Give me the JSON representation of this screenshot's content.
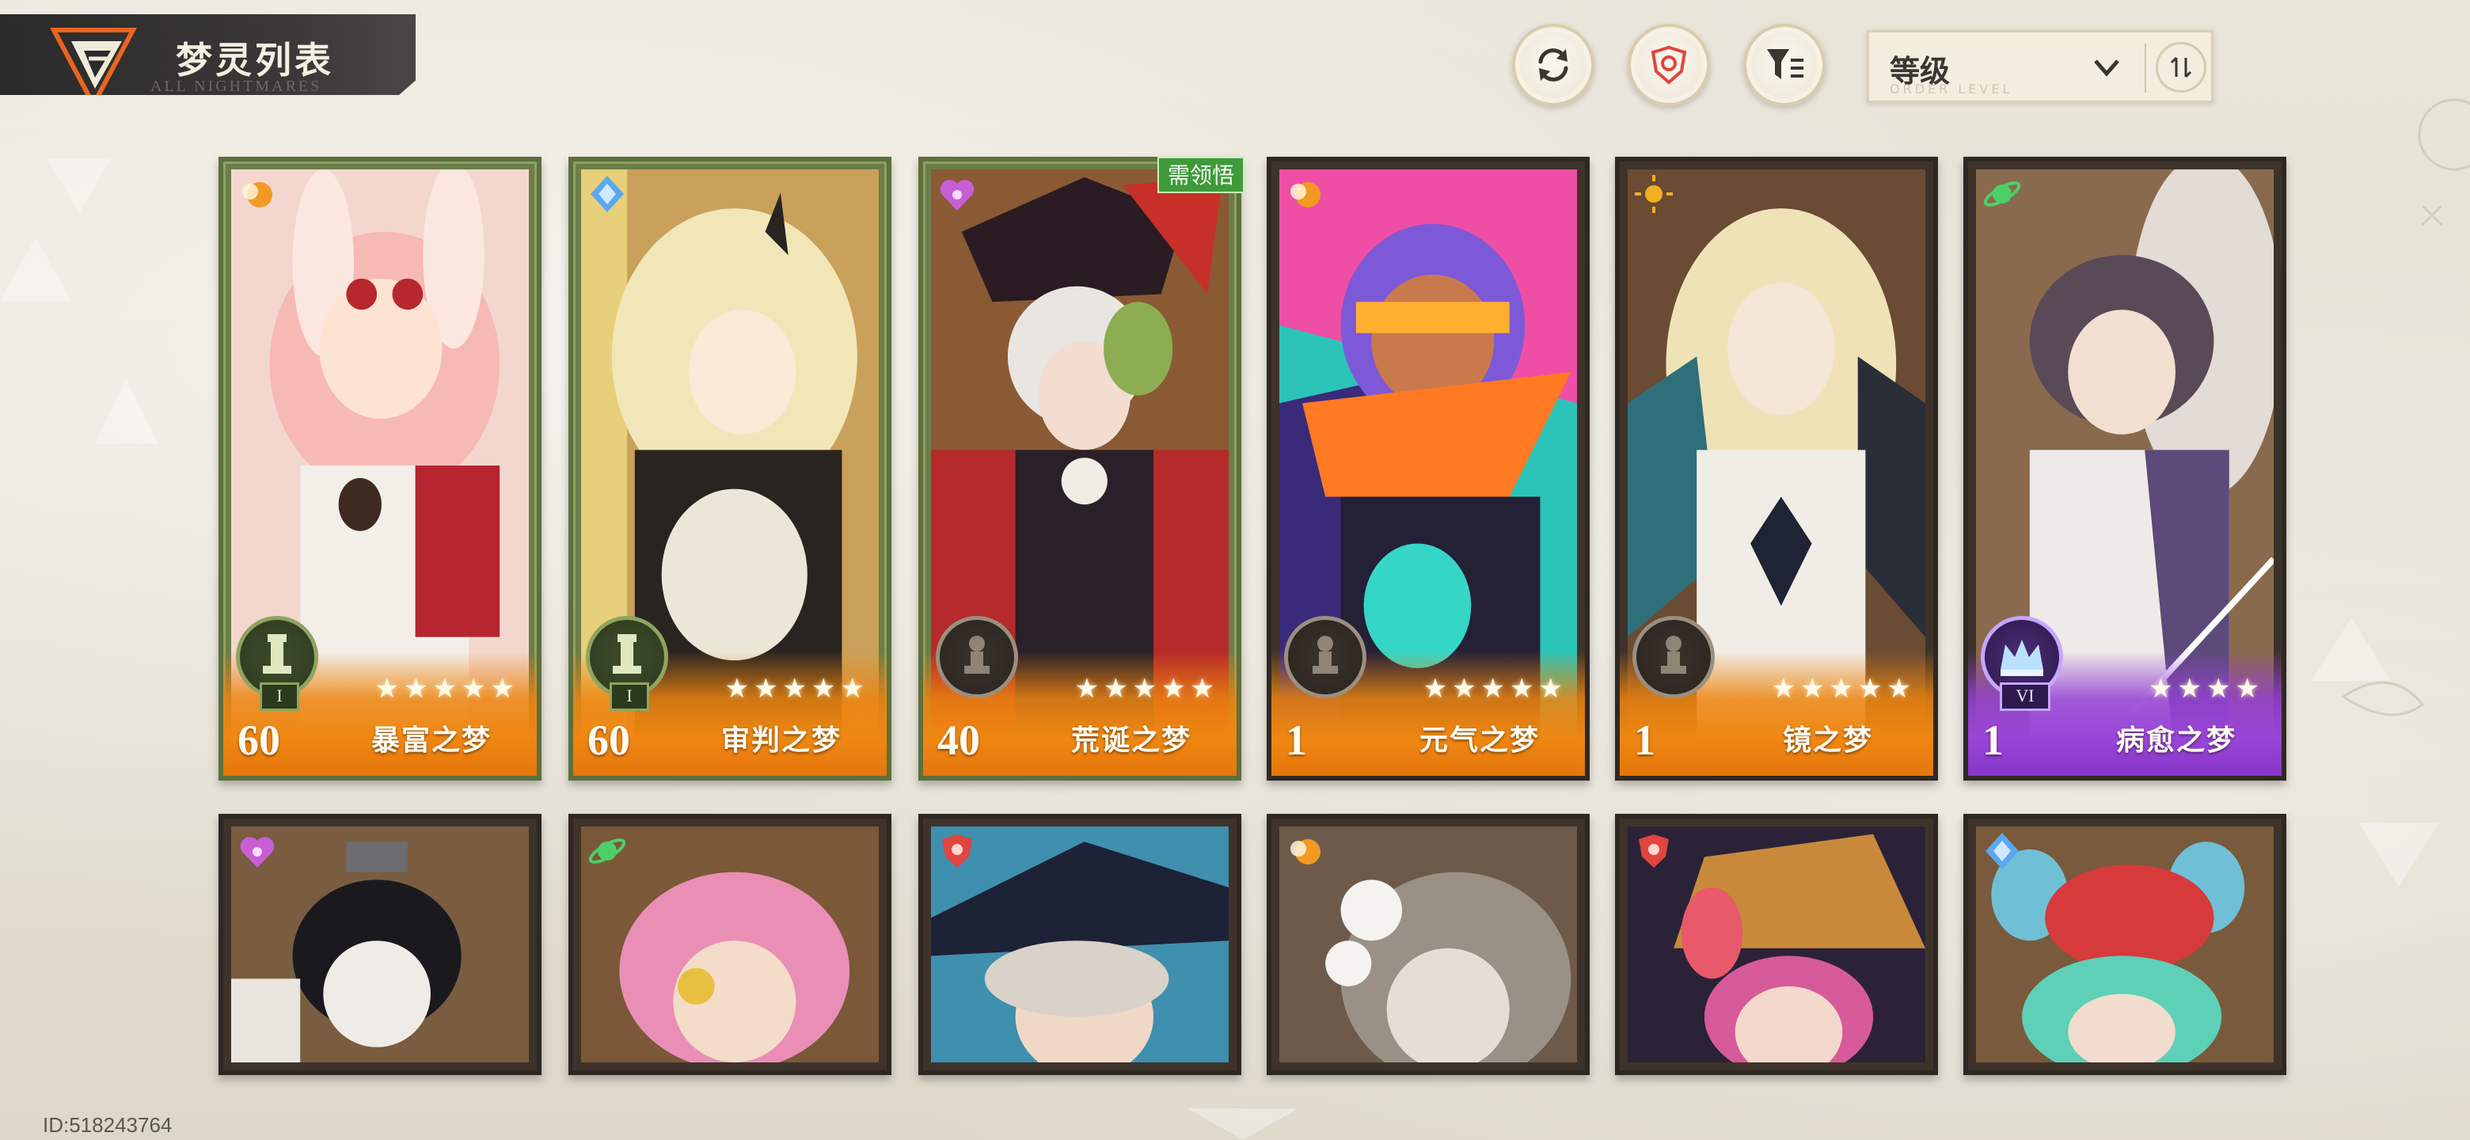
{
  "header": {
    "title": "梦灵列表",
    "subtitle_ghost": "ALL NIGHTMARES"
  },
  "controls": {
    "refresh_icon": "refresh-icon",
    "shield_icon": "shield-filter-icon",
    "filter_icon": "funnel-filter-icon",
    "sort": {
      "label": "等级",
      "ghost_text": "ORDER LEVEL",
      "dropdown_icon": "chevron-down-icon",
      "order_icon": "sort-order-icon"
    }
  },
  "cards_row1": [
    {
      "level": "60",
      "name": "暴富之梦",
      "stars": "★★★★★",
      "rank": "I",
      "frame": "green",
      "footer": "orange",
      "element_color": "#f29a24"
    },
    {
      "level": "60",
      "name": "审判之梦",
      "stars": "★★★★★",
      "rank": "I",
      "frame": "green",
      "footer": "orange",
      "element_color": "#5aa8f0"
    },
    {
      "level": "40",
      "name": "荒诞之梦",
      "stars": "★★★★★",
      "rank": "",
      "frame": "green",
      "footer": "orange",
      "element_color": "#c85ed6",
      "tag": "需领悟"
    },
    {
      "level": "1",
      "name": "元气之梦",
      "stars": "★★★★★",
      "rank": "",
      "frame": "dark",
      "footer": "orange",
      "element_color": "#f29a24"
    },
    {
      "level": "1",
      "name": "镜之梦",
      "stars": "★★★★★",
      "rank": "",
      "frame": "dark",
      "footer": "orange",
      "element_color": "#f0b020"
    },
    {
      "level": "1",
      "name": "病愈之梦",
      "stars": "★★★★",
      "rank": "VI",
      "frame": "dark",
      "footer": "purple",
      "element_color": "#4ccf6a"
    }
  ],
  "cards_row2": [
    {
      "element_color": "#c85ed6"
    },
    {
      "element_color": "#4ccf6a"
    },
    {
      "element_color": "#e0453e"
    },
    {
      "element_color": "#f29a24"
    },
    {
      "element_color": "#e0453e"
    },
    {
      "element_color": "#5aa8f0"
    }
  ],
  "footer": {
    "user_id": "ID:518243764"
  },
  "colors": {
    "accent_orange": "#ef8712",
    "accent_purple": "#9a45d8",
    "frame_green": "#6b7d48",
    "tag_green": "#3f9a3b"
  }
}
